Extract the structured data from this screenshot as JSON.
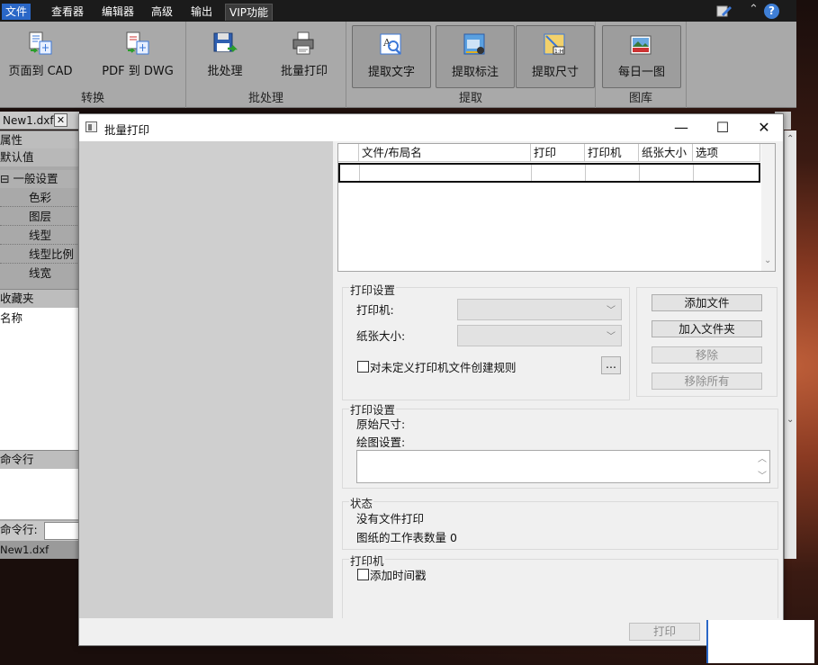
{
  "menubar": {
    "items": [
      "文件",
      "查看器",
      "编辑器",
      "高级",
      "输出",
      "VIP功能"
    ]
  },
  "ribbon": {
    "groups": [
      {
        "label": "转换",
        "buttons": [
          "页面到 CAD",
          "PDF 到 DWG"
        ]
      },
      {
        "label": "批处理",
        "buttons": [
          "批处理",
          "批量打印"
        ]
      },
      {
        "label": "提取",
        "buttons": [
          "提取文字",
          "提取标注",
          "提取尺寸"
        ]
      },
      {
        "label": "图库",
        "buttons": [
          "每日一图"
        ]
      }
    ]
  },
  "doc_tab": {
    "label": "New1.dxf"
  },
  "left_panel": {
    "properties_title": "属性",
    "default_value": "默认值",
    "general_section": "⊟ 一般设置",
    "properties": [
      "色彩",
      "图层",
      "线型",
      "线型比例",
      "线宽"
    ],
    "favorites_title": "收藏夹",
    "name_label": "名称",
    "command_line_title": "命令行",
    "command_prompt": "命令行:",
    "status_file": "New1.dxf"
  },
  "dialog": {
    "title": "批量打印",
    "table_headers": [
      "文件/布局名",
      "打印",
      "打印机",
      "纸张大小",
      "选项"
    ],
    "print_settings_1": {
      "title": "打印设置",
      "printer_label": "打印机:",
      "paper_label": "纸张大小:",
      "rule_checkbox": "对未定义打印机文件创建规则",
      "browse": "..."
    },
    "file_buttons": {
      "add_file": "添加文件",
      "add_folder": "加入文件夹",
      "remove": "移除",
      "remove_all": "移除所有"
    },
    "print_settings_2": {
      "title": "打印设置",
      "original_size": "原始尺寸:",
      "plot_settings": "绘图设置:"
    },
    "status": {
      "title": "状态",
      "no_files": "没有文件打印",
      "sheet_count": "图纸的工作表数量 0"
    },
    "printer_section": {
      "title": "打印机",
      "timestamp_checkbox": "添加时间戳"
    },
    "print_button": "打印"
  },
  "colors": {
    "accent": "#2a67c7",
    "ribbon": "#a9a9a9"
  }
}
